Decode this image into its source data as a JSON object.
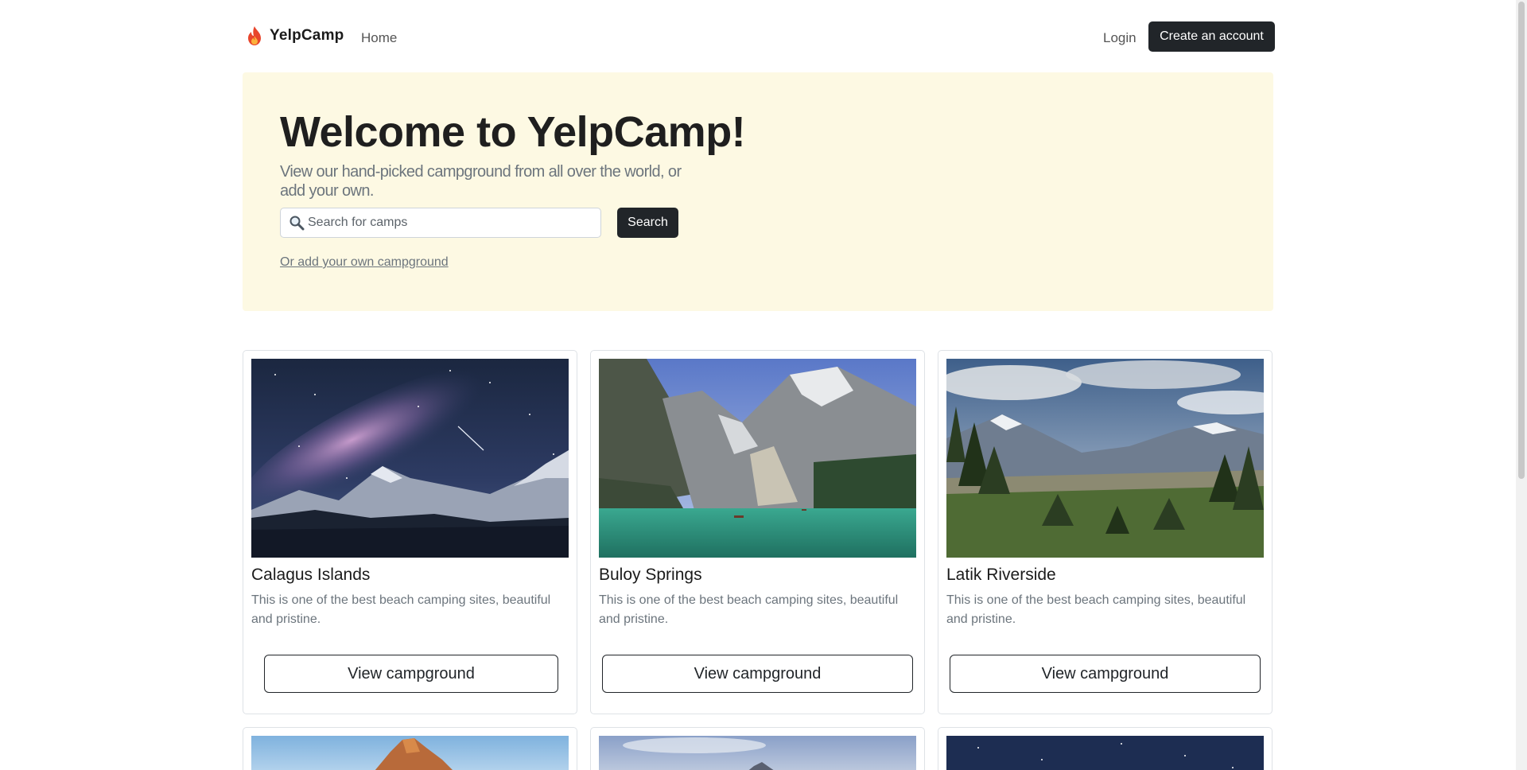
{
  "nav": {
    "brand": "YelpCamp",
    "home": "Home",
    "login": "Login",
    "create_account": "Create an account"
  },
  "hero": {
    "title": "Welcome to YelpCamp!",
    "subtitle": "View our hand-picked campground from all over the world, or add your own.",
    "search_placeholder": "Search for camps",
    "search_value": "",
    "search_button": "Search",
    "add_link": "Or add your own campground"
  },
  "campgrounds": [
    {
      "name": "Calagus Islands",
      "description": "This is one of the best beach camping sites, beautiful and pristine.",
      "button": "View campground",
      "image": "night-mountain-milky-way"
    },
    {
      "name": "Buloy Springs",
      "description": "This is one of the best beach camping sites, beautiful and pristine.",
      "button": "View campground",
      "image": "alpine-lake-mountains"
    },
    {
      "name": "Latik Riverside",
      "description": "This is one of the best beach camping sites, beautiful and pristine.",
      "button": "View campground",
      "image": "valley-forest-mountains"
    }
  ],
  "colors": {
    "hero_bg": "#fdf9e3",
    "dark_button": "#212529",
    "muted_text": "#6c757d",
    "flame": "#e8452c"
  },
  "icons": {
    "brand": "flame-icon",
    "search": "magnifier-icon"
  }
}
